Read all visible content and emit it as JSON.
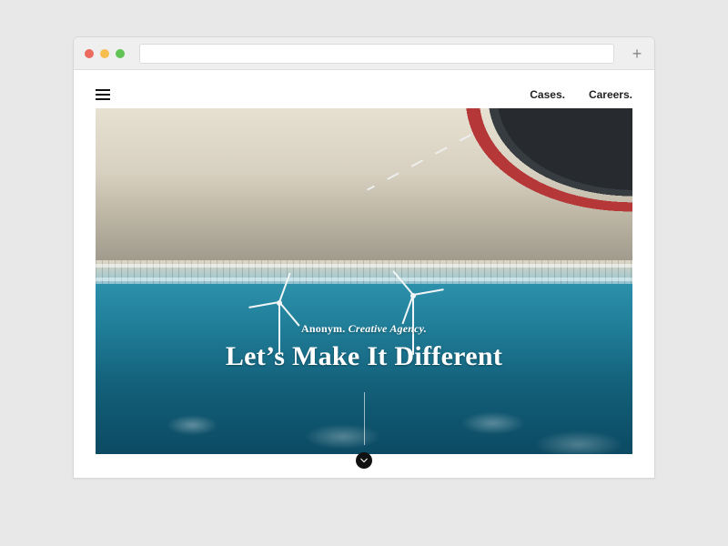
{
  "browser": {
    "address": "",
    "new_tab_glyph": "+"
  },
  "nav": {
    "links": [
      "Cases.",
      "Careers."
    ]
  },
  "hero": {
    "brand": "Anonym.",
    "tagline_suffix": " Creative Agency.",
    "headline": "Let’s Make It Different"
  }
}
